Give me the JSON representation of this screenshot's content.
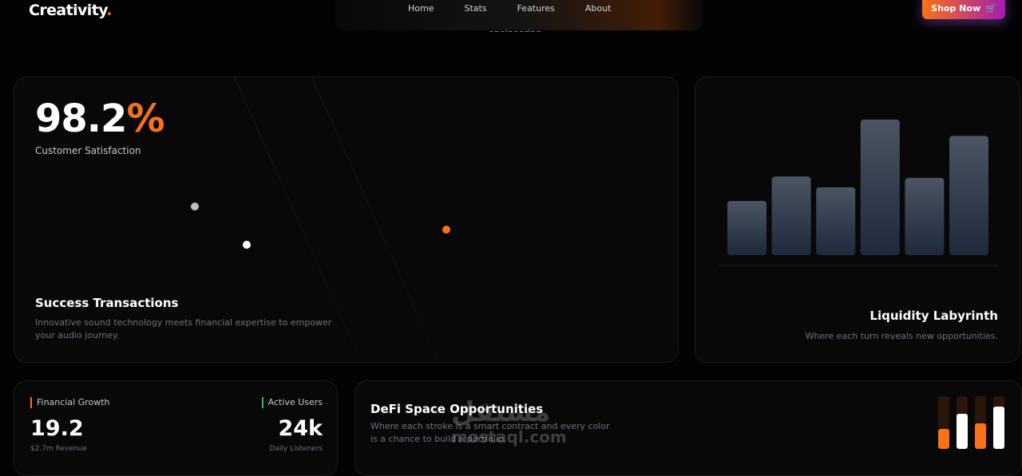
{
  "header": {
    "brand": "Creativity",
    "brand_dot": ".",
    "nav": [
      "Home",
      "Stats",
      "Features",
      "About"
    ],
    "subtitle_fragment": "engineering.",
    "shop_label": "Shop Now",
    "shop_icon": "cart-icon"
  },
  "satisfaction_card": {
    "value": "98.2",
    "value_suffix": "%",
    "label": "Customer Satisfaction",
    "title": "Success Transactions",
    "description": "Innovative sound technology meets financial expertise to empower your audio journey."
  },
  "liquidity_card": {
    "title": "Liquidity Labyrinth",
    "description": "Where each turn reveals new opportunities.",
    "bar_values": [
      0.4,
      0.58,
      0.5,
      1.0,
      0.57,
      0.88
    ]
  },
  "stats_card": {
    "left_label": "Financial Growth",
    "left_value": "19.2",
    "left_sub": "$2.7m Revenue",
    "right_label": "Active Users",
    "right_value": "24k",
    "right_sub": "Daily Listeners"
  },
  "defi_card": {
    "title": "DeFi Space Opportunities",
    "description": "Where each stroke is a smart contract and every color is a chance to build a portfolio.",
    "levels": [
      {
        "value": 0.38,
        "color": "#f97316"
      },
      {
        "value": 0.66,
        "color": "#ffffff"
      },
      {
        "value": 0.48,
        "color": "#f97316"
      },
      {
        "value": 0.8,
        "color": "#ffffff"
      }
    ]
  },
  "watermark": {
    "arabic": "مستقل",
    "latin": "mostaql.com"
  },
  "colors": {
    "accent": "#f97316",
    "accent_green": "#22c55e",
    "bar_top": "#4b5563",
    "bar_bottom": "#1e293b"
  }
}
